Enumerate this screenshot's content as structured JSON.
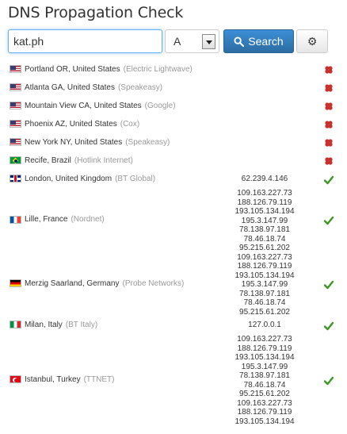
{
  "app": {
    "title": "DNS Propagation Check"
  },
  "search": {
    "query_value": "kat.ph",
    "record_type": "A",
    "button_label": "Search",
    "settings_icon": "gear-icon"
  },
  "colors": {
    "primary": "#3277b5",
    "ok": "#3a9a1f",
    "fail": "#c9302c"
  },
  "results": [
    {
      "location": "Portland OR, United States",
      "provider": "(Electric Lightwave)",
      "flag": "us",
      "status": "fail",
      "ips": []
    },
    {
      "location": "Atlanta GA, United States",
      "provider": "(Speakeasy)",
      "flag": "us",
      "status": "fail",
      "ips": []
    },
    {
      "location": "Mountain View CA, United States",
      "provider": "(Google)",
      "flag": "us",
      "status": "fail",
      "ips": []
    },
    {
      "location": "Phoenix AZ, United States",
      "provider": "(Cox)",
      "flag": "us",
      "status": "fail",
      "ips": []
    },
    {
      "location": "New York NY, United States",
      "provider": "(Speakeasy)",
      "flag": "us",
      "status": "fail",
      "ips": []
    },
    {
      "location": "Recife, Brazil",
      "provider": "(Hotlink Internet)",
      "flag": "br",
      "status": "fail",
      "ips": []
    },
    {
      "location": "London, United Kingdom",
      "provider": "(BT Global)",
      "flag": "gb",
      "status": "ok",
      "ips": [
        "62.239.4.146"
      ]
    },
    {
      "location": "Lille, France",
      "provider": "(Nordnet)",
      "flag": "fr",
      "status": "ok",
      "ips": [
        "109.163.227.73",
        "188.126.79.119",
        "193.105.134.194",
        "195.3.147.99",
        "78.138.97.181",
        "78.46.18.74",
        "95.215.61.202"
      ]
    },
    {
      "location": "Merzig Saarland, Germany",
      "provider": "(Probe Networks)",
      "flag": "de",
      "status": "ok",
      "ips": [
        "109.163.227.73",
        "188.126.79.119",
        "193.105.134.194",
        "195.3.147.99",
        "78.138.97.181",
        "78.46.18.74",
        "95.215.61.202"
      ]
    },
    {
      "location": "Milan, Italy",
      "provider": "(BT Italy)",
      "flag": "it",
      "status": "ok",
      "ips": [
        "127.0.0.1"
      ]
    },
    {
      "location": "Istanbul, Turkey",
      "provider": "(TTNET)",
      "flag": "tr",
      "status": "ok",
      "ips": [
        "109.163.227.73",
        "188.126.79.119",
        "193.105.134.194",
        "195.3.147.99",
        "78.138.97.181",
        "78.46.18.74",
        "95.215.61.202",
        "109.163.227.73",
        "188.126.79.119",
        "193.105.134.194"
      ]
    }
  ]
}
